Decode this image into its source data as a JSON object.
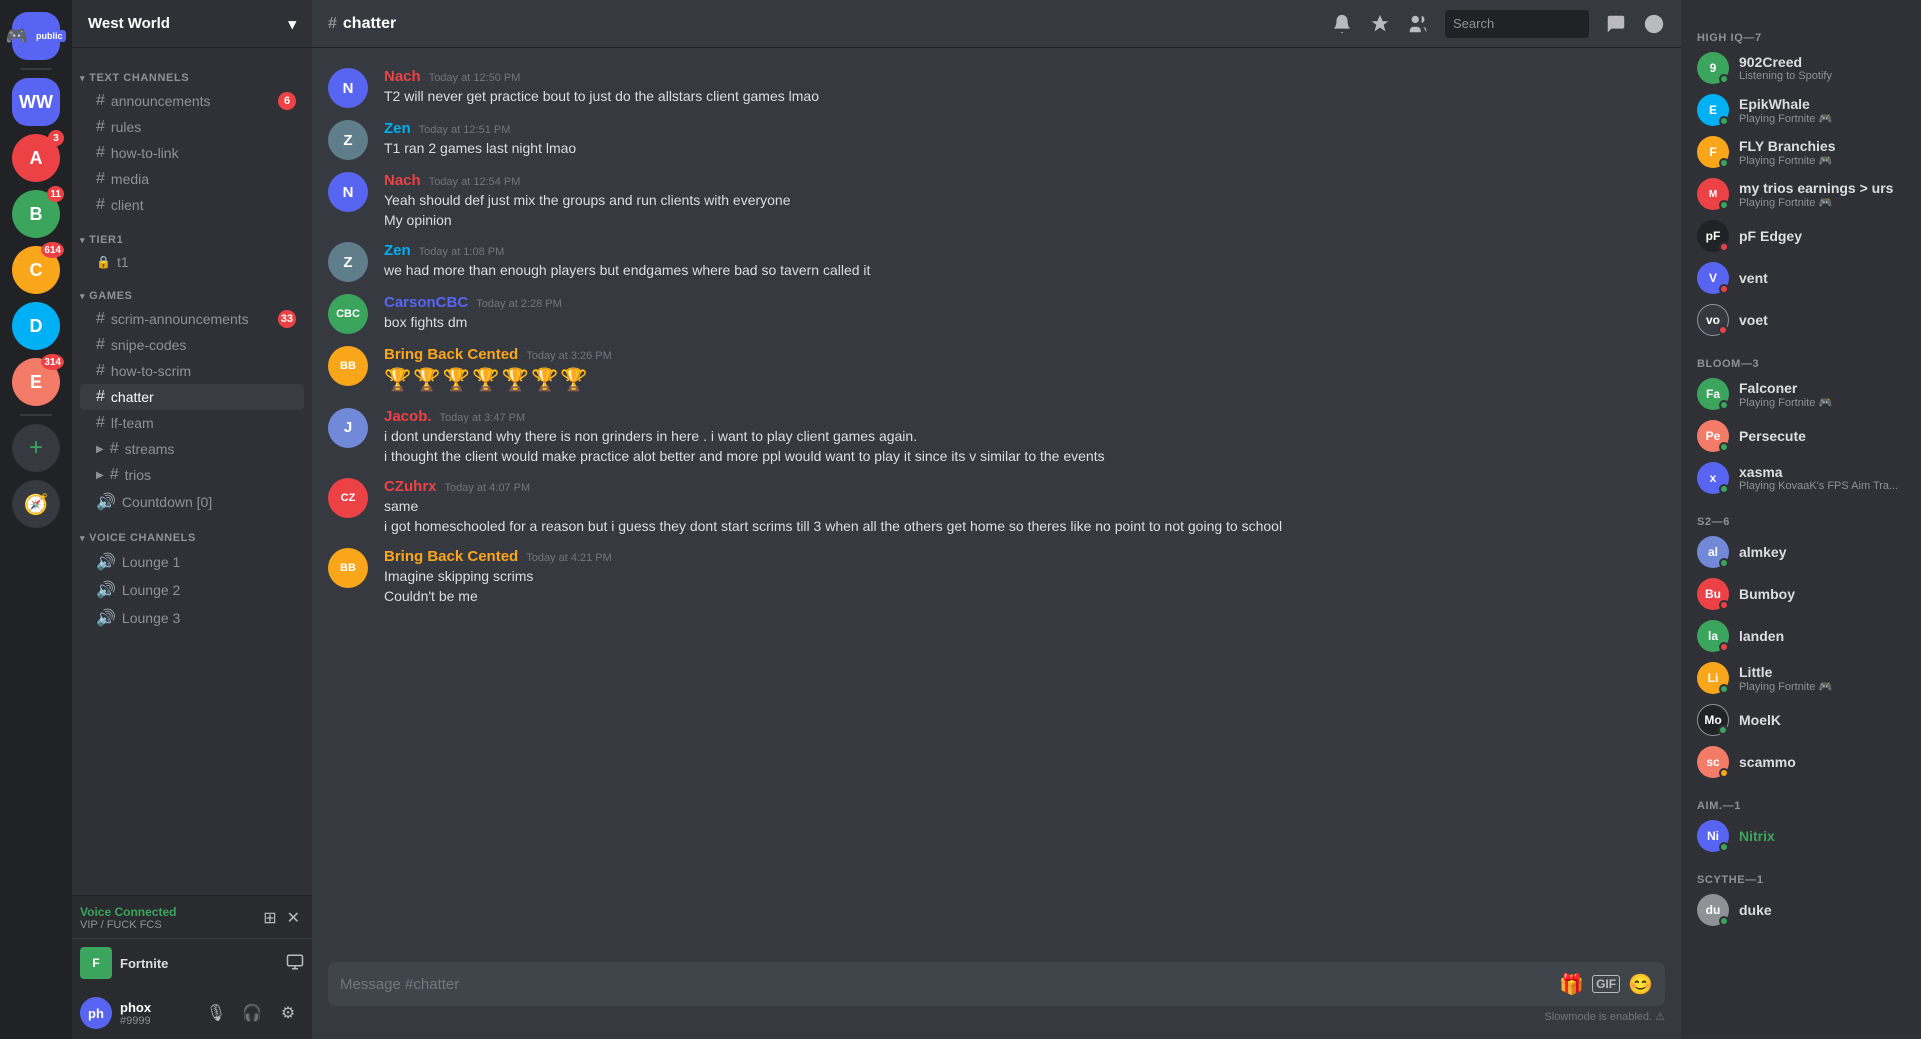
{
  "app": {
    "title": "Discord"
  },
  "server": {
    "name": "West World",
    "icon_text": "WW",
    "icon_color": "#5865f2"
  },
  "servers": [
    {
      "id": "home",
      "icon": "🏠",
      "color": "#5865f2",
      "badge": null
    },
    {
      "id": "s1",
      "icon": "W",
      "color": "#5865f2",
      "badge": null
    },
    {
      "id": "s2",
      "icon": "A",
      "color": "#ed4245",
      "badge": "3"
    },
    {
      "id": "s3",
      "icon": "B",
      "color": "#3ba55d",
      "badge": "11"
    },
    {
      "id": "s4",
      "icon": "C",
      "color": "#faa61a",
      "badge": "614"
    },
    {
      "id": "s5",
      "icon": "D",
      "color": "#00b0f4",
      "badge": null
    },
    {
      "id": "s6",
      "icon": "E",
      "color": "#f47b67",
      "badge": "314"
    }
  ],
  "categories": {
    "text": {
      "label": "TEXT CHANNELS",
      "channels": [
        {
          "id": "announcements",
          "name": "announcements",
          "type": "text",
          "badge": 6
        },
        {
          "id": "rules",
          "name": "rules",
          "type": "text",
          "badge": null
        },
        {
          "id": "how-to-link",
          "name": "how-to-link",
          "type": "text",
          "badge": null
        },
        {
          "id": "media",
          "name": "media",
          "type": "text",
          "badge": null
        },
        {
          "id": "client",
          "name": "client",
          "type": "text",
          "badge": null
        }
      ]
    },
    "tier1": {
      "label": "TIER1",
      "channels": [
        {
          "id": "t1",
          "name": "t1",
          "type": "locked",
          "badge": null
        }
      ]
    },
    "games": {
      "label": "GAMES",
      "channels": [
        {
          "id": "scrim-announcements",
          "name": "scrim-announcements",
          "type": "text",
          "badge": 33
        },
        {
          "id": "snipe-codes",
          "name": "snipe-codes",
          "type": "text",
          "badge": null
        },
        {
          "id": "how-to-scrim",
          "name": "how-to-scrim",
          "type": "text",
          "badge": null
        },
        {
          "id": "chatter",
          "name": "chatter",
          "type": "text",
          "badge": null,
          "active": true
        },
        {
          "id": "lf-team",
          "name": "lf-team",
          "type": "text",
          "badge": null
        },
        {
          "id": "streams",
          "name": "streams",
          "type": "text-group",
          "badge": null
        },
        {
          "id": "trios",
          "name": "trios",
          "type": "text-group",
          "badge": null
        },
        {
          "id": "countdown",
          "name": "Countdown [0]",
          "type": "voice",
          "badge": null
        }
      ]
    },
    "voice": {
      "label": "VOICE CHANNELS",
      "channels": [
        {
          "id": "lounge1",
          "name": "Lounge 1",
          "type": "voice",
          "badge": null
        },
        {
          "id": "lounge2",
          "name": "Lounge 2",
          "type": "voice",
          "badge": null
        },
        {
          "id": "lounge3",
          "name": "Lounge 3",
          "type": "voice",
          "badge": null
        }
      ]
    }
  },
  "channel": {
    "name": "chatter",
    "hash": "#"
  },
  "header": {
    "search_placeholder": "Search",
    "bell_icon": "🔔",
    "pin_icon": "📌",
    "members_icon": "👥"
  },
  "messages": [
    {
      "id": "m1",
      "author": "Nach",
      "author_color": "pink",
      "avatar_color": "#5865f2",
      "avatar_text": "N",
      "timestamp": "Today at 12:50 PM",
      "lines": [
        "T2 will never get practice bout to just do the allstars client games lmao"
      ]
    },
    {
      "id": "m2",
      "author": "Zen",
      "author_color": "teal",
      "avatar_color": "#8e9297",
      "avatar_text": "Z",
      "timestamp": "Today at 12:51 PM",
      "lines": [
        "T1 ran 2 games last night lmao"
      ]
    },
    {
      "id": "m3",
      "author": "Nach",
      "author_color": "pink",
      "avatar_color": "#5865f2",
      "avatar_text": "N",
      "timestamp": "Today at 12:54 PM",
      "lines": [
        "Yeah should def just mix the groups and run clients with everyone",
        "My opinion"
      ]
    },
    {
      "id": "m4",
      "author": "Zen",
      "author_color": "teal",
      "avatar_color": "#8e9297",
      "avatar_text": "Z",
      "timestamp": "Today at 1:08 PM",
      "lines": [
        "we had more than enough players but endgames where bad so tavern called it"
      ]
    },
    {
      "id": "m5",
      "author": "CarsonCBC",
      "author_color": "blue",
      "avatar_color": "#3ba55d",
      "avatar_text": "CBC",
      "timestamp": "Today at 2:28 PM",
      "lines": [
        "box fights dm"
      ]
    },
    {
      "id": "m6",
      "author": "Bring Back Cented",
      "author_color": "yellow",
      "avatar_color": "#faa61a",
      "avatar_text": "BB",
      "timestamp": "Today at 3:26 PM",
      "lines": [
        "emoji_sequence"
      ]
    },
    {
      "id": "m7",
      "author": "Jacob.",
      "author_color": "pink",
      "avatar_color": "#7289da",
      "avatar_text": "J",
      "timestamp": "Today at 3:47 PM",
      "lines": [
        "i dont understand why there is non grinders in here . i want to play client games again.",
        "i thought the client would make practice alot better and more ppl would want to play it since its v similar to the events"
      ]
    },
    {
      "id": "m8",
      "author": "CZuhrx",
      "author_color": "pink",
      "avatar_color": "#ed4245",
      "avatar_text": "CZ",
      "timestamp": "Today at 4:07 PM",
      "lines": [
        "same",
        "i got homeschooled for a reason but i guess they dont start scrims till 3 when all the others get home so theres like no point to not going to school"
      ]
    },
    {
      "id": "m9",
      "author": "Bring Back Cented",
      "author_color": "yellow",
      "avatar_color": "#faa61a",
      "avatar_text": "BB",
      "timestamp": "Today at 4:21 PM",
      "lines": [
        "Imagine skipping scrims",
        "Couldn't be me"
      ]
    }
  ],
  "message_input": {
    "placeholder": "Message #chatter"
  },
  "slowmode": "Slowmode is enabled.",
  "member_groups": [
    {
      "id": "high-iq",
      "label": "HIGH IQ—7",
      "members": [
        {
          "name": "902Creed",
          "activity": "Listening to Spotify",
          "avatar_color": "#3ba55d",
          "avatar_text": "9",
          "status": "online"
        },
        {
          "name": "EpikWhale",
          "activity": "Playing Fortnite 🎮",
          "avatar_color": "#00b0f4",
          "avatar_text": "E",
          "status": "online"
        },
        {
          "name": "FLY Branchies",
          "activity": "Playing Fortnite 🎮",
          "avatar_color": "#faa61a",
          "avatar_text": "F",
          "status": "online"
        },
        {
          "name": "my trios earnings > urs",
          "activity": "Playing Fortnite 🎮",
          "avatar_color": "#ed4245",
          "avatar_text": "M",
          "status": "online"
        },
        {
          "name": "pF Edgey",
          "activity": "",
          "avatar_color": "#202225",
          "avatar_text": "pF",
          "status": "dnd"
        },
        {
          "name": "vent",
          "activity": "",
          "avatar_color": "#5865f2",
          "avatar_text": "V",
          "status": "dnd"
        },
        {
          "name": "voet",
          "activity": "",
          "avatar_color": "#36393f",
          "avatar_text": "vo",
          "status": "dnd"
        }
      ]
    },
    {
      "id": "bloom",
      "label": "BLOOM—3",
      "members": [
        {
          "name": "Falconer",
          "activity": "Playing Fortnite 🎮",
          "avatar_color": "#3ba55d",
          "avatar_text": "Fa",
          "status": "online"
        },
        {
          "name": "Persecute",
          "activity": "",
          "avatar_color": "#f47b67",
          "avatar_text": "Pe",
          "status": "online"
        },
        {
          "name": "xasma",
          "activity": "Playing KovaaK's FPS Aim Tra...",
          "avatar_color": "#5865f2",
          "avatar_text": "x",
          "status": "online"
        }
      ]
    },
    {
      "id": "s2",
      "label": "S2—6",
      "members": [
        {
          "name": "almkey",
          "activity": "",
          "avatar_color": "#7289da",
          "avatar_text": "al",
          "status": "online"
        },
        {
          "name": "Bumboy",
          "activity": "",
          "avatar_color": "#ed4245",
          "avatar_text": "Bu",
          "status": "dnd"
        },
        {
          "name": "landen",
          "activity": "",
          "avatar_color": "#3ba55d",
          "avatar_text": "la",
          "status": "dnd"
        },
        {
          "name": "Little",
          "activity": "Playing Fortnite 🎮",
          "avatar_color": "#faa61a",
          "avatar_text": "Li",
          "status": "online"
        },
        {
          "name": "MoelK",
          "activity": "",
          "avatar_color": "#202225",
          "avatar_text": "Mo",
          "status": "online"
        },
        {
          "name": "scammo",
          "activity": "",
          "avatar_color": "#f47b67",
          "avatar_text": "sc",
          "status": "idle"
        }
      ]
    },
    {
      "id": "aim",
      "label": "AIM.—1",
      "members": [
        {
          "name": "Nitrix",
          "activity": "",
          "avatar_color": "#5865f2",
          "avatar_text": "Ni",
          "status": "online"
        }
      ]
    },
    {
      "id": "scythe",
      "label": "SCYTHE—1",
      "members": [
        {
          "name": "duke",
          "activity": "",
          "avatar_color": "#8e9297",
          "avatar_text": "du",
          "status": "online"
        }
      ]
    }
  ],
  "user": {
    "name": "phox",
    "tag": "#9999",
    "avatar_color": "#5865f2",
    "avatar_text": "ph"
  },
  "voice_connected": {
    "status": "Voice Connected",
    "channel": "VIP / FUCK FCS"
  },
  "game_activity": {
    "name": "Fortnite",
    "color": "#3ba55d"
  }
}
